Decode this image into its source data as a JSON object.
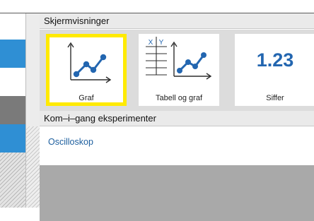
{
  "sections": {
    "screen_views": "Skjermvisninger",
    "experiments": "Kom–i–gang eksperimenter"
  },
  "tiles": [
    {
      "label": "Graf"
    },
    {
      "label": "Tabell og graf",
      "axis_labels": [
        "X",
        "Y"
      ]
    },
    {
      "label": "Siffer",
      "value": "1.23"
    }
  ],
  "experiments": {
    "oscilloscope": "Oscilloskop"
  },
  "colors": {
    "selected_border": "#ffea00",
    "accent_blue": "#2366b0",
    "link": "#1c5e9e"
  }
}
